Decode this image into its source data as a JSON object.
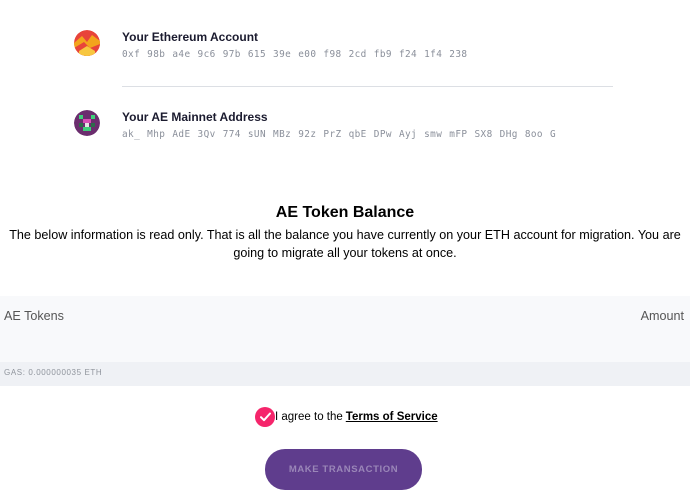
{
  "eth_account": {
    "title": "Your Ethereum Account",
    "address": "0xf 98b a4e 9c6 97b 615 39e e00 f98 2cd fb9 f24 1f4 238"
  },
  "ae_account": {
    "title": "Your AE Mainnet Address",
    "address": "ak_ Mhp AdE 3Qv 774 sUN MBz 92z PrZ qbE DPw Ayj smw mFP SX8 DHg 8oo G"
  },
  "balance": {
    "title": "AE Token Balance",
    "description": "The below information is read only. That is all the balance you have currently on your ETH account for migration. You are going to migrate all your tokens at once."
  },
  "table": {
    "col_tokens": "AE Tokens",
    "col_amount": "Amount",
    "gas": "GAS: 0.000000035 ETH"
  },
  "agreement": {
    "prefix": "I agree to the",
    "link": "Terms of Service",
    "checked": true
  },
  "actions": {
    "make_transaction": "MAKE TRANSACTION"
  },
  "colors": {
    "accent_pink": "#f5256b",
    "button_purple": "#5f3d8d"
  }
}
